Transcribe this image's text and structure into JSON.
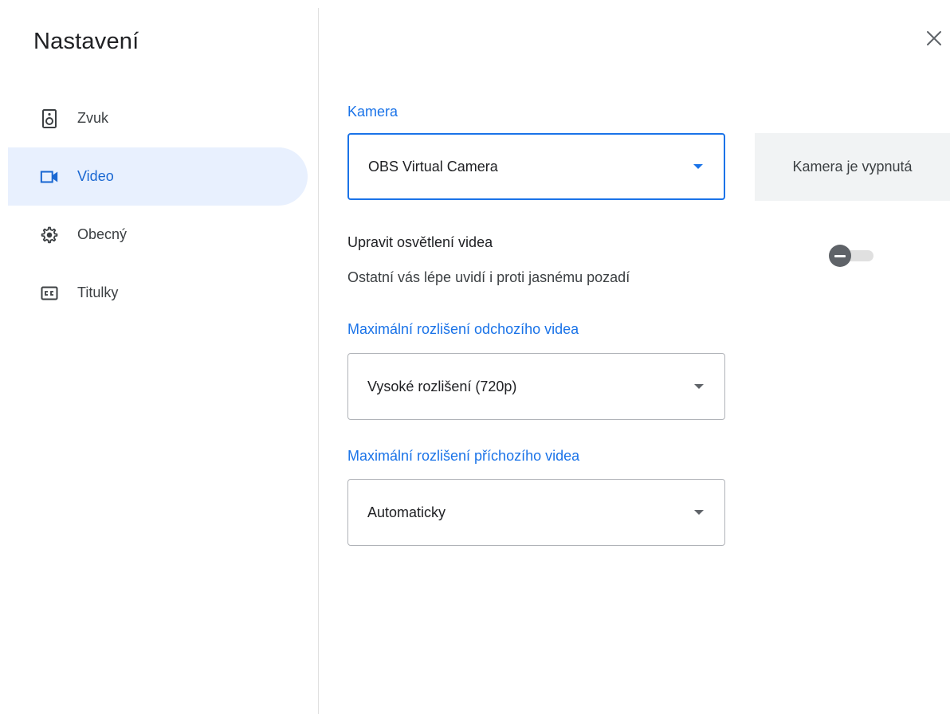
{
  "dialog": {
    "title": "Nastavení",
    "close_icon": "close-icon"
  },
  "sidebar": {
    "items": [
      {
        "label": "Zvuk",
        "icon": "speaker-icon",
        "active": false
      },
      {
        "label": "Video",
        "icon": "videocam-icon",
        "active": true
      },
      {
        "label": "Obecný",
        "icon": "gear-icon",
        "active": false
      },
      {
        "label": "Titulky",
        "icon": "closed-captions-icon",
        "active": false
      }
    ]
  },
  "video": {
    "camera": {
      "label": "Kamera",
      "value": "OBS Virtual Camera"
    },
    "preview": {
      "text": "Kamera je vypnutá"
    },
    "lighting": {
      "title": "Upravit osvětlení videa",
      "description": "Ostatní vás lépe uvidí i proti jasnému pozadí",
      "enabled": false
    },
    "outgoing": {
      "label": "Maximální rozlišení odchozího videa",
      "value": "Vysoké rozlišení (720p)"
    },
    "incoming": {
      "label": "Maximální rozlišení příchozího videa",
      "value": "Automaticky"
    }
  },
  "colors": {
    "accent": "#1a73e8",
    "active_bg": "#e8f0fe",
    "text": "#3c4043"
  }
}
